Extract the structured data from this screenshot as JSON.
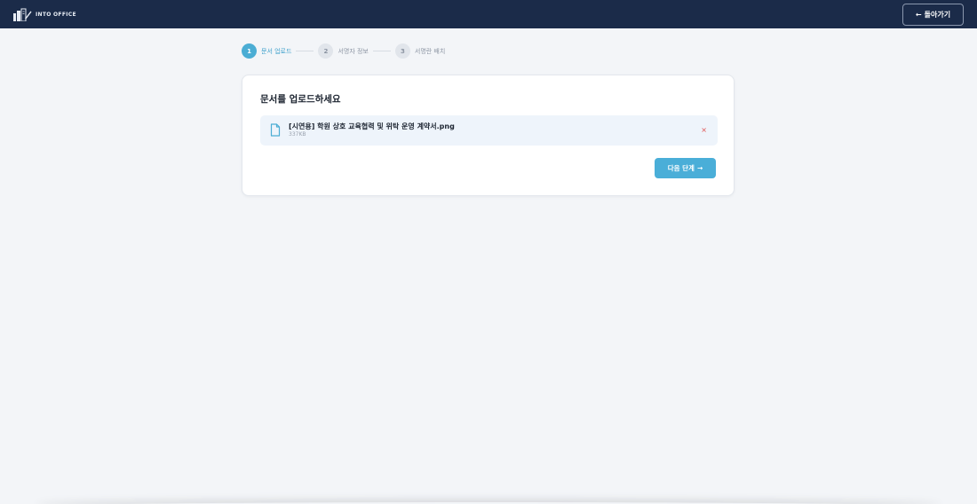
{
  "header": {
    "logo_text": "INTO OFFICE",
    "logo_icon": "buildings-pen-icon",
    "back_button": {
      "arrow": "←",
      "label": "돌아가기"
    }
  },
  "stepper": {
    "steps": [
      {
        "number": "1",
        "label": "문서 업로드",
        "state": "active"
      },
      {
        "number": "2",
        "label": "서명자 정보",
        "state": "inactive"
      },
      {
        "number": "3",
        "label": "서명란 배치",
        "state": "inactive"
      }
    ]
  },
  "upload_card": {
    "title": "문서를 업로드하세요",
    "file": {
      "icon": "document-icon",
      "name": "[시연용] 학원 상호 교육협력 및 위탁 운영 계약서.png",
      "size": "337KB",
      "remove": "×"
    },
    "next_button": {
      "label": "다음 단계",
      "arrow": "→"
    }
  },
  "colors": {
    "header_bg": "#1b2b49",
    "accent": "#4badd4",
    "page_bg": "#f3f5f8",
    "remove": "#e05252"
  }
}
